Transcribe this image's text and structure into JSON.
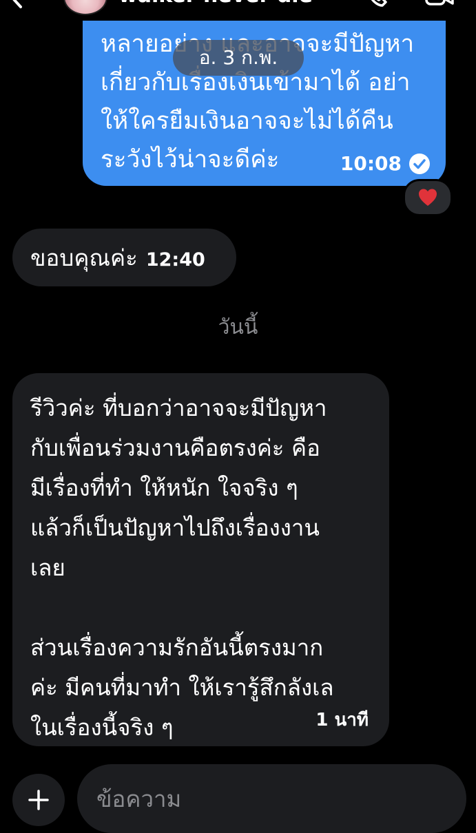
{
  "header": {
    "contact_name": "walker never die"
  },
  "conversation": {
    "outgoing": {
      "lines": [
        "หลายอย่าง และอาจจะมีปัญหา",
        "เกี่ยวกับเรื่องเงินเข้ามาได้ อย่า",
        "ให้ใครยืมเงินอาจจะไม่ได้คืน",
        "ระวังไว้น่าจะดีค่ะ"
      ],
      "time": "10:08",
      "reaction": "❤️"
    },
    "date_label": "อ. 3 ก.พ.",
    "reply_short": {
      "text": "ขอบคุณค่ะ",
      "time": "12:40"
    },
    "day_divider": "วันนี้",
    "reply_long": {
      "lines": [
        "รีวิวค่ะ ที่บอกว่าอาจจะมีปัญหา",
        "กับเพื่อนร่วมงานคือตรงค่ะ คือ",
        "มีเรื่องที่ทำ ให้หนัก ใจจริง ๆ",
        "แล้วก็เป็นปัญหาไปถึงเรื่องงาน",
        "เลย",
        "",
        "ส่วนเรื่องความรักอันนี้ตรงมาก",
        "ค่ะ มีคนที่มาทำ ให้เรารู้สึกลังเล",
        "ในเรื่องนี้จริง ๆ"
      ],
      "time": "1 นาที"
    }
  },
  "composer": {
    "placeholder": "ข้อความ"
  },
  "colors": {
    "outgoing_bubble": "#3d8ef0",
    "incoming_bubble": "#1c1d20",
    "background": "#000000"
  }
}
